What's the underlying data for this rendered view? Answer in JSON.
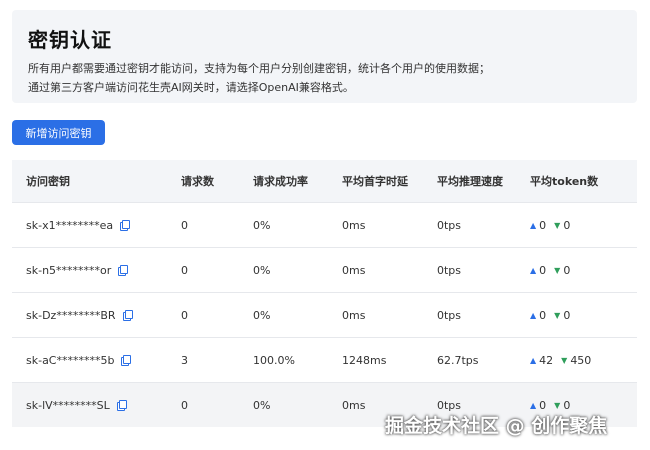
{
  "header": {
    "title": "密钥认证",
    "desc_line1": "所有用户都需要通过密钥才能访问，支持为每个用户分别创建密钥，统计各个用户的使用数据；",
    "desc_line2": "通过第三方客户端访问花生壳AI网关时，请选择OpenAI兼容格式。"
  },
  "toolbar": {
    "add_key_label": "新增访问密钥"
  },
  "table": {
    "columns": [
      "访问密钥",
      "请求数",
      "请求成功率",
      "平均首字时延",
      "平均推理速度",
      "平均token数"
    ],
    "rows": [
      {
        "key": "sk-x1********ea",
        "requests": "0",
        "success_rate": "0%",
        "first_token_latency": "0ms",
        "speed": "0tps",
        "tokens_in": "0",
        "tokens_out": "0"
      },
      {
        "key": "sk-n5********or",
        "requests": "0",
        "success_rate": "0%",
        "first_token_latency": "0ms",
        "speed": "0tps",
        "tokens_in": "0",
        "tokens_out": "0"
      },
      {
        "key": "sk-Dz********BR",
        "requests": "0",
        "success_rate": "0%",
        "first_token_latency": "0ms",
        "speed": "0tps",
        "tokens_in": "0",
        "tokens_out": "0"
      },
      {
        "key": "sk-aC********5b",
        "requests": "3",
        "success_rate": "100.0%",
        "first_token_latency": "1248ms",
        "speed": "62.7tps",
        "tokens_in": "42",
        "tokens_out": "450"
      },
      {
        "key": "sk-lV********SL",
        "requests": "0",
        "success_rate": "0%",
        "first_token_latency": "0ms",
        "speed": "0tps",
        "tokens_in": "0",
        "tokens_out": "0"
      }
    ]
  },
  "icons": {
    "copy": "copy-icon",
    "up": "triangle-up-icon",
    "down": "triangle-down-icon"
  },
  "colors": {
    "accent": "#2b6fe6",
    "down": "#2f9e5b",
    "panel_bg": "#f3f5f8"
  },
  "watermark": "掘金技术社区 @ 创作聚焦"
}
